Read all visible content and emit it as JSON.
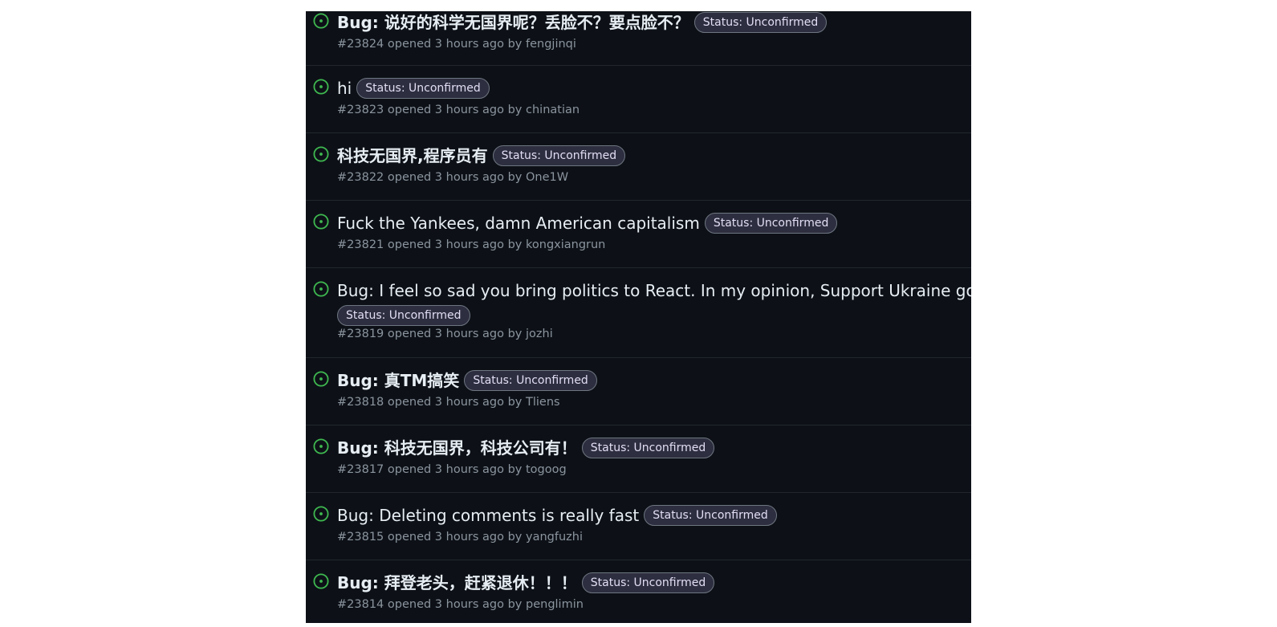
{
  "issues": [
    {
      "title": "Bug: 说好的科学无国界呢？丢脸不？要点脸不？",
      "label": "Status: Unconfirmed",
      "number": "#23824",
      "opened": "opened 3 hours ago by",
      "author": "fengjinqi"
    },
    {
      "title": "hi",
      "label": "Status: Unconfirmed",
      "number": "#23823",
      "opened": "opened 3 hours ago by",
      "author": "chinatian"
    },
    {
      "title": "科技无国界,程序员有",
      "label": "Status: Unconfirmed",
      "number": "#23822",
      "opened": "opened 3 hours ago by",
      "author": "One1W"
    },
    {
      "title": "Fuck the Yankees, damn American capitalism",
      "label": "Status: Unconfirmed",
      "number": "#23821",
      "opened": "opened 3 hours ago by",
      "author": "kongxiangrun"
    },
    {
      "title": "Bug: I feel so sad you bring politics to React. In my opinion, Support Ukraine gover",
      "label": "Status: Unconfirmed",
      "number": "#23819",
      "opened": "opened 3 hours ago by",
      "author": "jozhi"
    },
    {
      "title": "Bug: 真TM搞笑",
      "label": "Status: Unconfirmed",
      "number": "#23818",
      "opened": "opened 3 hours ago by",
      "author": "Tliens"
    },
    {
      "title": "Bug: 科技无国界，科技公司有！",
      "label": "Status: Unconfirmed",
      "number": "#23817",
      "opened": "opened 3 hours ago by",
      "author": "togoog"
    },
    {
      "title": "Bug: Deleting comments is really fast",
      "label": "Status: Unconfirmed",
      "number": "#23815",
      "opened": "opened 3 hours ago by",
      "author": "yangfuzhi"
    },
    {
      "title": "Bug: 拜登老头，赶紧退休！！！",
      "label": "Status: Unconfirmed",
      "number": "#23814",
      "opened": "opened 3 hours ago by",
      "author": "penglimin"
    }
  ],
  "colors": {
    "background": "#0d1117",
    "open_icon": "#3fb950",
    "label_fill": "#2d2e3f",
    "label_border": "#6e7681"
  },
  "icons": {
    "status": "issue-opened-icon"
  }
}
